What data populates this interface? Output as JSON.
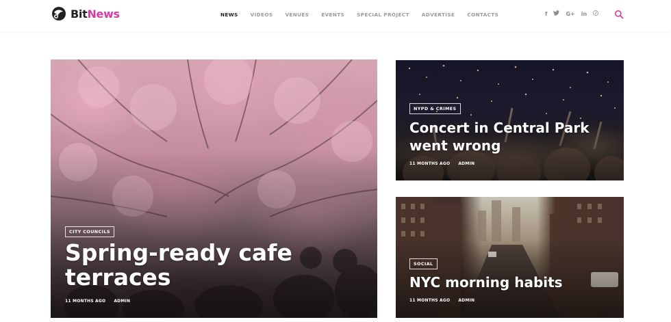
{
  "brand": {
    "name_part1": "Bit",
    "name_part2": "News",
    "accent": "#d63aa7"
  },
  "nav": {
    "items": [
      {
        "label": "NEWS",
        "active": true
      },
      {
        "label": "VIDEOS",
        "active": false
      },
      {
        "label": "VENUES",
        "active": false
      },
      {
        "label": "EVENTS",
        "active": false
      },
      {
        "label": "SPECIAL PROJECT",
        "active": false
      },
      {
        "label": "ADVERTISE",
        "active": false
      },
      {
        "label": "CONTACTS",
        "active": false
      }
    ]
  },
  "social": {
    "facebook": "f",
    "twitter": "t",
    "google": "G+",
    "linkedin": "in",
    "pinterest": "p"
  },
  "search": {
    "icon": "search-icon"
  },
  "articles": {
    "main": {
      "category": "CITY COUNCILS",
      "title": "Spring-ready cafe terraces",
      "time": "11 MONTHS AGO",
      "author": "ADMIN"
    },
    "concert": {
      "category": "NYPD & CRIMES",
      "title": "Concert in Central Park went wrong",
      "time": "11 MONTHS AGO",
      "author": "ADMIN"
    },
    "nyc": {
      "category": "SOCIAL",
      "title": "NYC morning habits",
      "time": "11 MONTHS AGO",
      "author": "ADMIN"
    }
  }
}
